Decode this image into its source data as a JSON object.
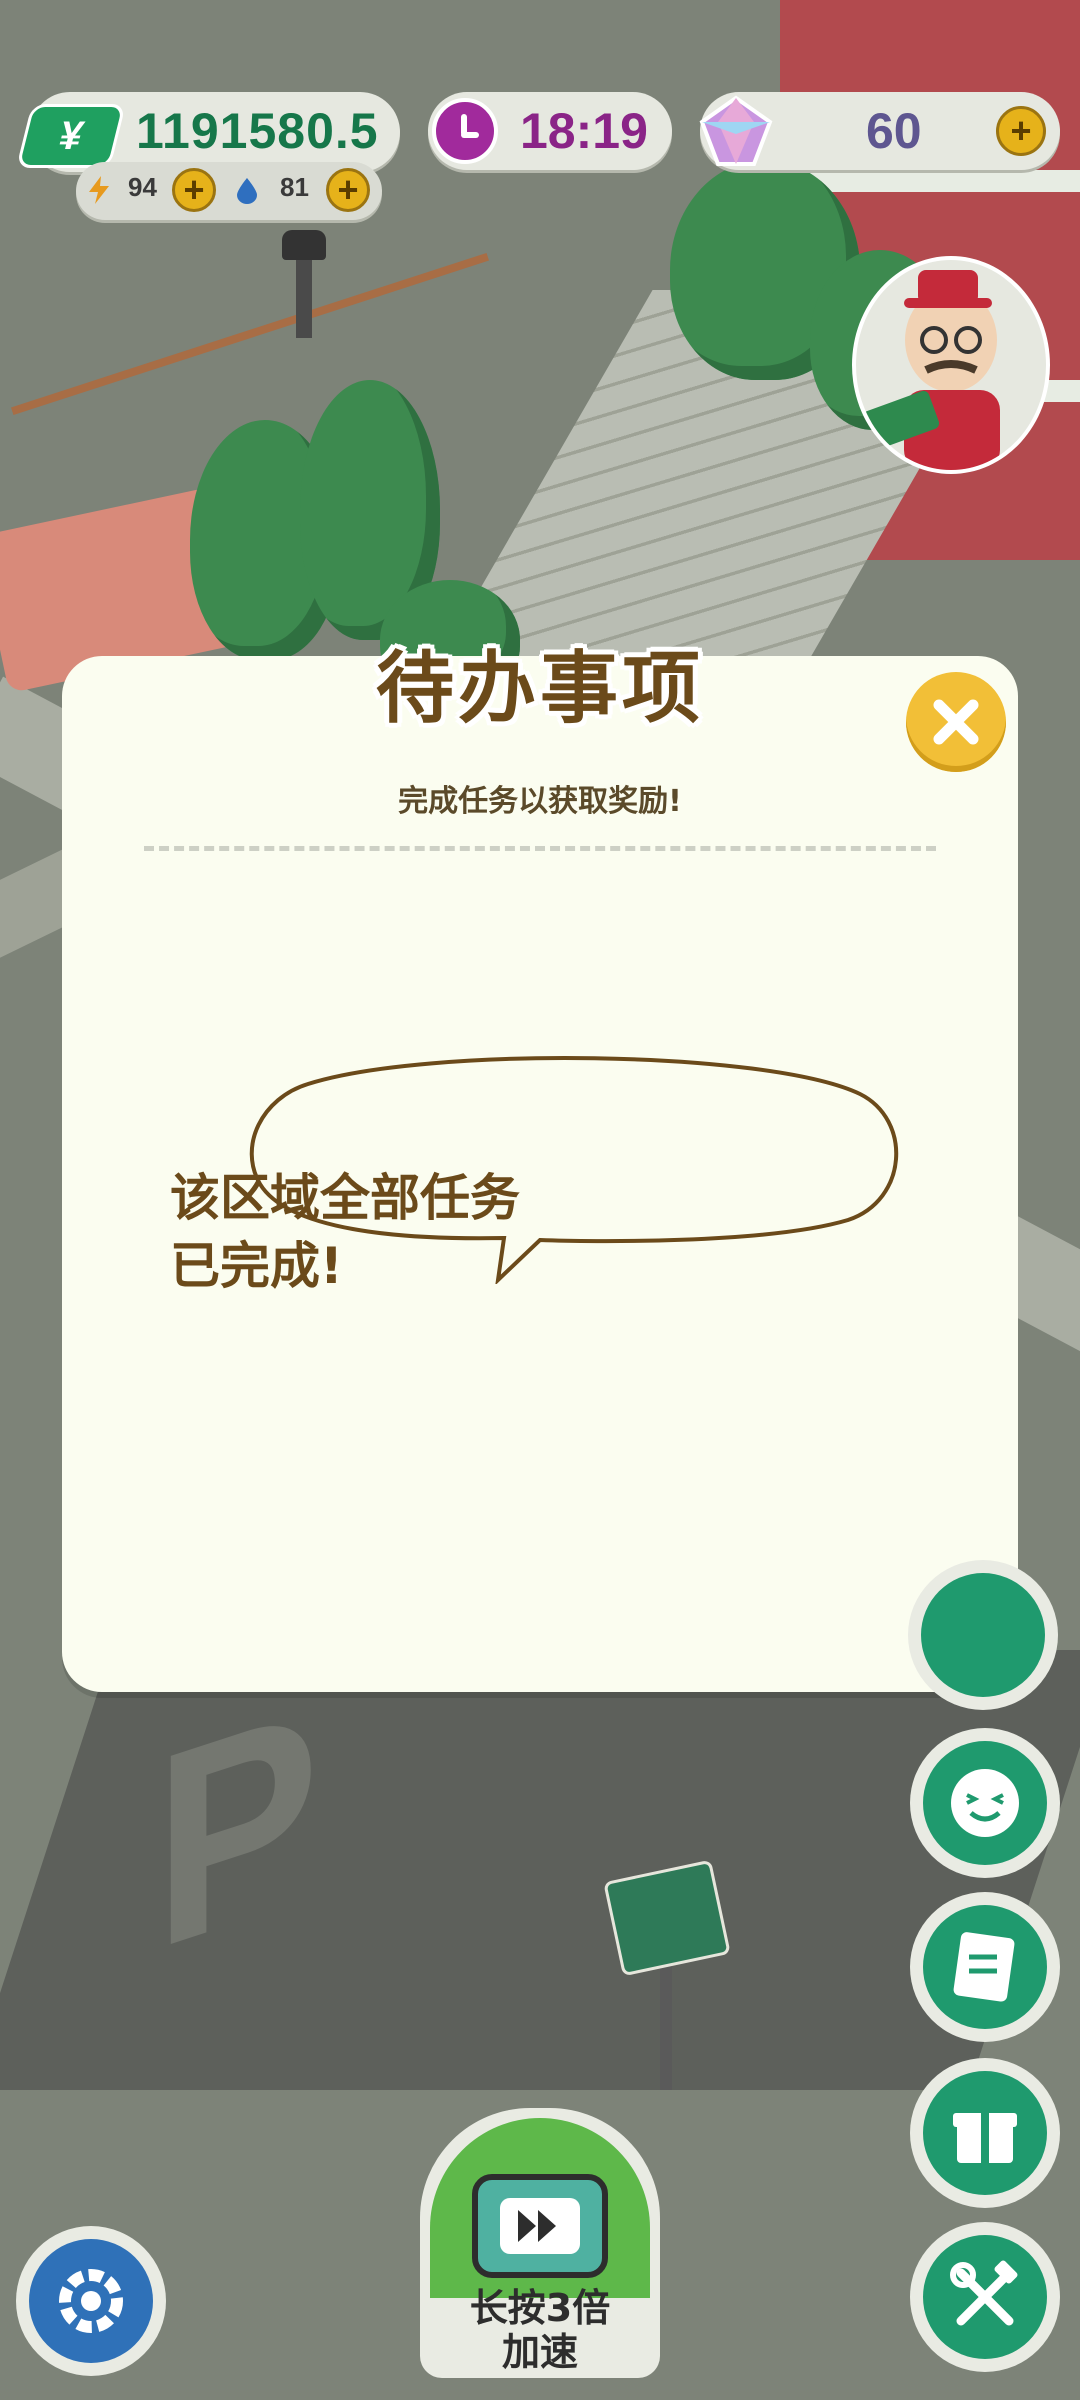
{
  "hud": {
    "money": "1191580.5",
    "money_symbol": "¥",
    "energy": "94",
    "water": "81",
    "time": "18:19",
    "gems": "60"
  },
  "panel": {
    "title": "待办事项",
    "subtitle": "完成任务以获取奖励!",
    "message_line1": "该区域全部任务",
    "message_line2": "已完成!"
  },
  "speed_button": {
    "line1": "长按3倍",
    "line2": "加速"
  },
  "colors": {
    "money": "#16774a",
    "time": "#8a2487",
    "gem": "#5e5690",
    "panel_bg": "#fbfdf0",
    "title": "#6b4a1a",
    "close": "#f2bf37",
    "side_button": "#1f9a6e"
  }
}
